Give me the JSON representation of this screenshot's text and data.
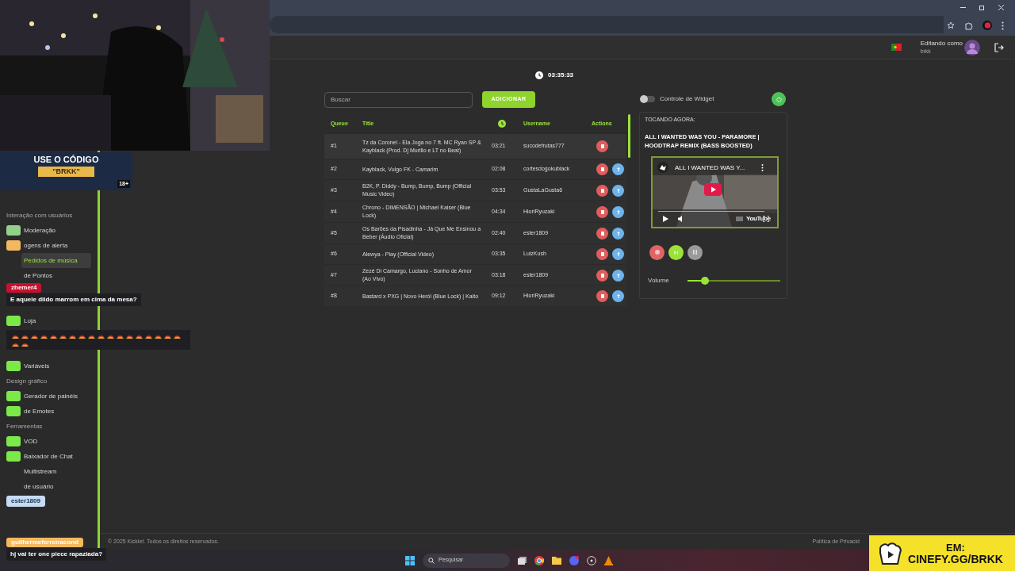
{
  "header": {
    "editing_label": "Editando como",
    "username": "brkk"
  },
  "clock": "03:35:33",
  "search": {
    "placeholder": "Buscar"
  },
  "add_button": "ADICIONAR",
  "table": {
    "columns": [
      {
        "kind": "text",
        "label": "Queue"
      },
      {
        "kind": "text",
        "label": "Title"
      },
      {
        "kind": "icon"
      },
      {
        "kind": "text",
        "label": "Username"
      },
      {
        "kind": "text",
        "label": "Actions"
      }
    ],
    "rows": [
      {
        "queue": "#1",
        "title": "Tz da Coronel - Ela Joga no 7 ft. MC Ryan SP & Kayblack (Prod. Dj Murillo e LT no Beat)",
        "duration": "03:21",
        "username": "sucodefrutas777",
        "can_move_up": false
      },
      {
        "queue": "#2",
        "title": "Kayblack, Vulgo FK - Camarim",
        "duration": "02:08",
        "username": "cortesdogokublack",
        "can_move_up": true
      },
      {
        "queue": "#3",
        "title": "B2K, P. Diddy - Bump, Bump, Bump (Official Music Video)",
        "duration": "03:53",
        "username": "GustaLaGusta6",
        "can_move_up": true
      },
      {
        "queue": "#4",
        "title": "Chrono - DIMENSÃO | Michael Kaiser (Blue Lock)",
        "duration": "04:34",
        "username": "HioriRyuzaki",
        "can_move_up": true
      },
      {
        "queue": "#5",
        "title": "Os Barões da Pisadinha - Já Que Me Ensinou a Beber (Áudio Oficial)",
        "duration": "02:40",
        "username": "ester1809",
        "can_move_up": true
      },
      {
        "queue": "#6",
        "title": "Alewya - Play (Official Video)",
        "duration": "03:35",
        "username": "LuizKush",
        "can_move_up": true
      },
      {
        "queue": "#7",
        "title": "Zezé Di Camargo, Luciano - Sonho de Amor (Ao Vivo)",
        "duration": "03:18",
        "username": "ester1809",
        "can_move_up": true
      },
      {
        "queue": "#8",
        "title": "Bastard x PXG | Novo Herói (Blue Lock) | Kaito",
        "duration": "09:12",
        "username": "HioriRyuzaki",
        "can_move_up": true
      }
    ]
  },
  "widget": {
    "toggle_label": "Controle de Widget",
    "on": false
  },
  "now_playing": {
    "label": "TOCANDO AGORA:",
    "title": "ALL I WANTED WAS YOU - PARAMORE | HOODTRAP REMIX (BASS BOOSTED)",
    "video_title": "ALL I WANTED WAS Y...",
    "video_brand": "YouTube"
  },
  "volume": {
    "label": "Volume",
    "level": 0.19
  },
  "sidebar": {
    "items": [
      {
        "kind": "section",
        "label": "Interação com usuários"
      },
      {
        "kind": "item",
        "label": "Moderação",
        "selected": false
      },
      {
        "kind": "item",
        "label": "ogens de alerta",
        "selected": false
      },
      {
        "kind": "item",
        "label": "Pedidos de música",
        "selected": true
      },
      {
        "kind": "item",
        "label": "de Pontos",
        "selected": false
      },
      {
        "kind": "spacer"
      },
      {
        "kind": "spacer"
      },
      {
        "kind": "item",
        "label": "Loja",
        "selected": false
      },
      {
        "kind": "spacer"
      },
      {
        "kind": "spacer"
      },
      {
        "kind": "item",
        "label": "Variáveis",
        "selected": false
      },
      {
        "kind": "section",
        "label": "Design gráfico"
      },
      {
        "kind": "item",
        "label": "Gerador de painéis",
        "selected": false
      },
      {
        "kind": "item",
        "label": "de Emotes",
        "selected": false
      },
      {
        "kind": "section",
        "label": "Ferramentas"
      },
      {
        "kind": "item",
        "label": "VOD",
        "selected": false
      },
      {
        "kind": "item",
        "label": "Baixador de Chat",
        "selected": false
      },
      {
        "kind": "item",
        "label": "Multistream",
        "selected": false
      },
      {
        "kind": "item",
        "label": "de usuário",
        "selected": false
      }
    ]
  },
  "chat": [
    {
      "kind": "text",
      "user": "zhemer4",
      "color": "#c8102e",
      "text": "E aquele dildo marrom em cima da mesa?"
    },
    {
      "kind": "name",
      "user": "ester1809",
      "color": "#c6dcf5"
    },
    {
      "kind": "text",
      "user": "guilhermeferreiracond",
      "color": "#f4b860",
      "text": "hj vai ter one piece rapaziada?"
    }
  ],
  "footer": {
    "copyright": "© 2025 Kicklet. Todos os direitos reservados.",
    "privacy": "Política de Privacid"
  },
  "taskbar": {
    "search_placeholder": "Pesquisar"
  },
  "promo": {
    "line1": "USE O CÓDIGO",
    "code": "\"BRKK\"",
    "badge": "18+"
  },
  "banner": {
    "line1": "EM:",
    "line2": "CINEFY.GG/BRKK"
  }
}
